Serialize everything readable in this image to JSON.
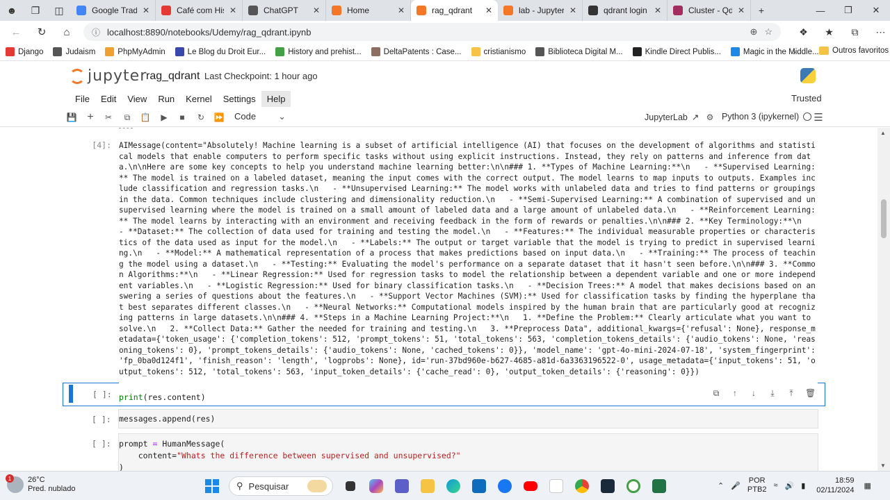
{
  "browser": {
    "tabs": [
      {
        "label": "Google Tradutor",
        "color": "#4285f4"
      },
      {
        "label": "Café com Histór",
        "color": "#e53935"
      },
      {
        "label": "ChatGPT",
        "color": "#555555"
      },
      {
        "label": "Home",
        "color": "#f37726"
      },
      {
        "label": "rag_qdrant",
        "color": "#f37726",
        "active": true
      },
      {
        "label": "lab - JupyterLab",
        "color": "#f37726"
      },
      {
        "label": "qdrant login - Pe",
        "color": "#333333"
      },
      {
        "label": "Cluster - Qdrant",
        "color": "#a32d5f"
      }
    ],
    "url": "localhost:8890/notebooks/Udemy/rag_qdrant.ipynb",
    "bookmarks": [
      {
        "label": "Django",
        "color": "#e53935"
      },
      {
        "label": "Judaism",
        "color": "#555555"
      },
      {
        "label": "PhpMyAdmin",
        "color": "#f0a030"
      },
      {
        "label": "Le Blog du Droit Eur...",
        "color": "#3949ab"
      },
      {
        "label": "History and prehist...",
        "color": "#43a047"
      },
      {
        "label": "DeltaPatents : Case...",
        "color": "#8d6e63"
      },
      {
        "label": "cristianismo",
        "color": "#f6c344"
      },
      {
        "label": "Biblioteca Digital M...",
        "color": "#555555"
      },
      {
        "label": "Kindle Direct Publis...",
        "color": "#222222"
      },
      {
        "label": "Magic in the Middle...",
        "color": "#1e88e5"
      }
    ],
    "other_bookmarks": "Outros favoritos"
  },
  "jupyter": {
    "logo_text": "jupyter",
    "notebook_name": "rag_qdrant",
    "checkpoint": "Last Checkpoint: 1 hour ago",
    "menu": [
      "File",
      "Edit",
      "View",
      "Run",
      "Kernel",
      "Settings",
      "Help"
    ],
    "trusted": "Trusted",
    "cell_type": "Code",
    "jupyterlab_link": "JupyterLab",
    "kernel_name": "Python 3 (ipykernel)"
  },
  "output": {
    "prompt": "[4]:",
    "text": "AIMessage(content=\"Absolutely! Machine learning is a subset of artificial intelligence (AI) that focuses on the development of algorithms and statistical models that enable computers to perform specific tasks without using explicit instructions. Instead, they rely on patterns and inference from data.\\n\\nHere are some key concepts to help you understand machine learning better:\\n\\n### 1. **Types of Machine Learning:**\\n   - **Supervised Learning:** The model is trained on a labeled dataset, meaning the input comes with the correct output. The model learns to map inputs to outputs. Examples include classification and regression tasks.\\n   - **Unsupervised Learning:** The model works with unlabeled data and tries to find patterns or groupings in the data. Common techniques include clustering and dimensionality reduction.\\n   - **Semi-Supervised Learning:** A combination of supervised and unsupervised learning where the model is trained on a small amount of labeled data and a large amount of unlabeled data.\\n   - **Reinforcement Learning:** The model learns by interacting with an environment and receiving feedback in the form of rewards or penalties.\\n\\n### 2. **Key Terminology:**\\n   - **Dataset:** The collection of data used for training and testing the model.\\n   - **Features:** The individual measurable properties or characteristics of the data used as input for the model.\\n   - **Labels:** The output or target variable that the model is trying to predict in supervised learning.\\n   - **Model:** A mathematical representation of a process that makes predictions based on input data.\\n   - **Training:** The process of teaching the model using a dataset.\\n   - **Testing:** Evaluating the model's performance on a separate dataset that it hasn't seen before.\\n\\n### 3. **Common Algorithms:**\\n   - **Linear Regression:** Used for regression tasks to model the relationship between a dependent variable and one or more independent variables.\\n   - **Logistic Regression:** Used for binary classification tasks.\\n   - **Decision Trees:** A model that makes decisions based on answering a series of questions about the features.\\n   - **Support Vector Machines (SVM):** Used for classification tasks by finding the hyperplane that best separates different classes.\\n   - **Neural Networks:** Computational models inspired by the human brain that are particularly good at recognizing patterns in large datasets.\\n\\n### 4. **Steps in a Machine Learning Project:**\\n   1. **Define the Problem:** Clearly articulate what you want to solve.\\n   2. **Collect Data:** Gather the needed for training and testing.\\n   3. **Preprocess Data\", additional_kwargs={'refusal': None}, response_metadata={'token_usage': {'completion_tokens': 512, 'prompt_tokens': 51, 'total_tokens': 563, 'completion_tokens_details': {'audio_tokens': None, 'reasoning_tokens': 0}, 'prompt_tokens_details': {'audio_tokens': None, 'cached_tokens': 0}}, 'model_name': 'gpt-4o-mini-2024-07-18', 'system_fingerprint': 'fp_0ba0d124f1', 'finish_reason': 'length', 'logprobs': None}, id='run-37bd960e-b627-4685-a81d-6a3363196522-0', usage_metadata={'input_tokens': 51, 'output_tokens': 512, 'total_tokens': 563, 'input_token_details': {'cache_read': 0}, 'output_token_details': {'reasoning': 0}})"
  },
  "cells": [
    {
      "prompt": "[ ]:",
      "code_fn": "print",
      "code_arg": "(res.content)"
    },
    {
      "prompt": "[ ]:",
      "code_obj": "messages.append",
      "code_arg": "(res)"
    },
    {
      "prompt": "[ ]:",
      "line1_a": "prompt ",
      "line1_op": "=",
      "line1_b": " HumanMessage(",
      "line2_a": "    content=",
      "line2_str": "\"Whats the difference between supervised and unsupervised?\"",
      "line3": ")"
    }
  ],
  "taskbar": {
    "temp": "26°C",
    "weather": "Pred. nublado",
    "badge": "1",
    "search": "Pesquisar",
    "lang1": "POR",
    "lang2": "PTB2",
    "time": "18:59",
    "date": "02/11/2024"
  }
}
